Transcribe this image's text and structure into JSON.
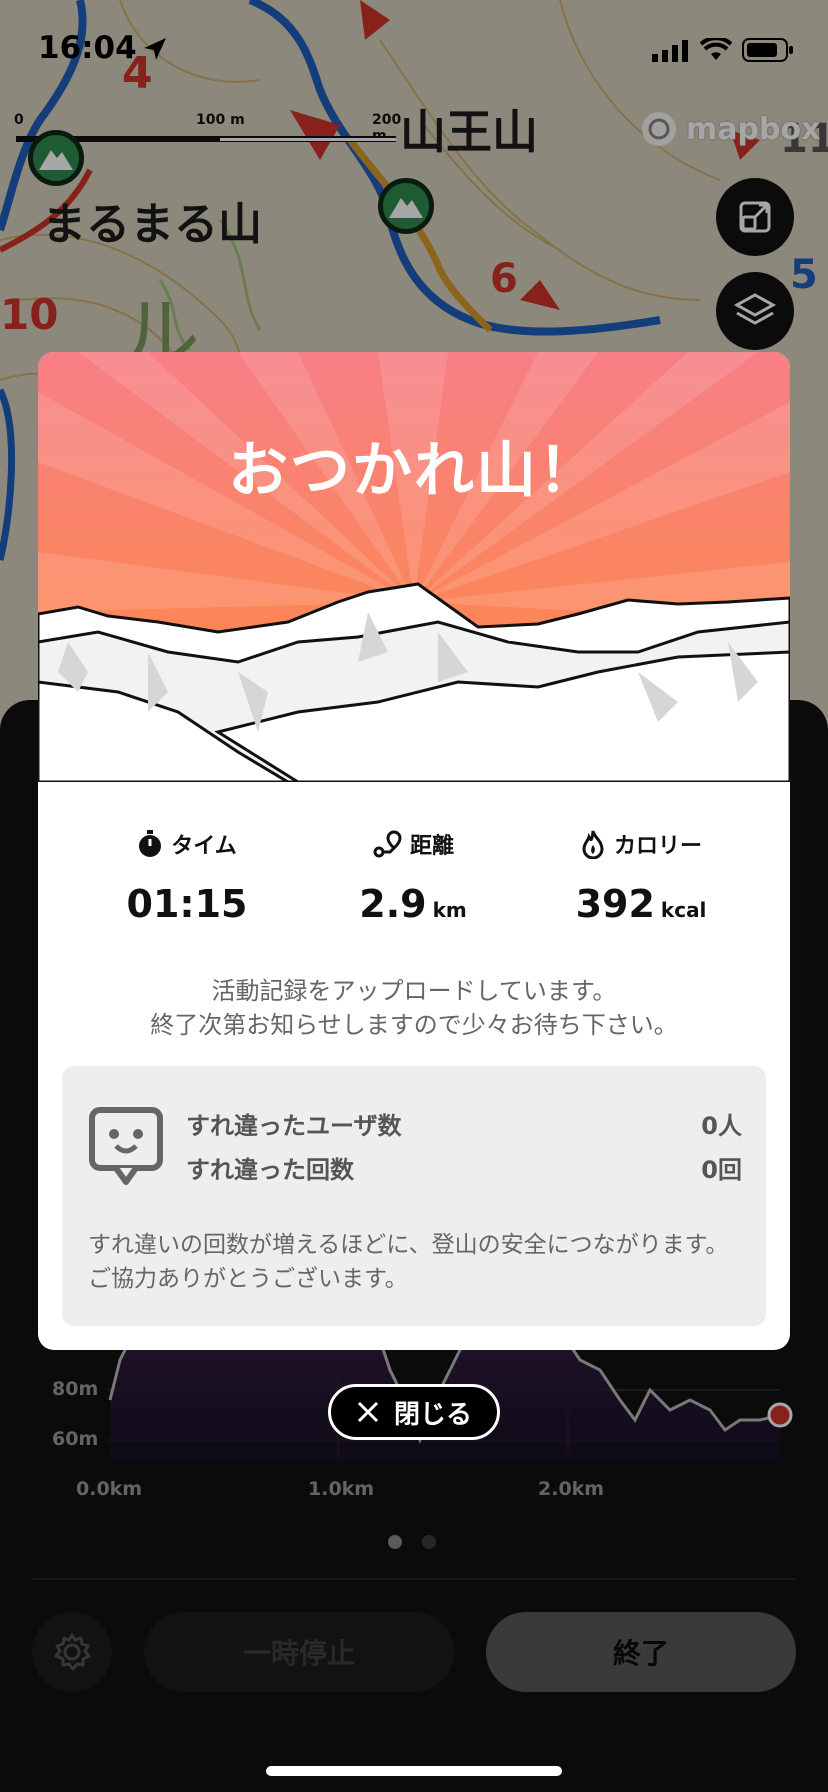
{
  "status_bar": {
    "time": "16:04"
  },
  "map": {
    "scale": {
      "zero": "0",
      "mid": "100 m",
      "max": "200 m"
    },
    "labels": {
      "peak1": "まるまる山",
      "peak2": "山王山",
      "n4": "4",
      "n6": "6",
      "n10": "10",
      "n11": "11",
      "n5": "5",
      "katakana": "ル"
    },
    "attribution": "mapbox"
  },
  "modal": {
    "title": "おつかれ山！",
    "stats": [
      {
        "label": "タイム",
        "value": "01:15",
        "unit": "",
        "icon": "stopwatch-icon"
      },
      {
        "label": "距離",
        "value": "2.9",
        "unit": "km",
        "icon": "route-pin-icon"
      },
      {
        "label": "カロリー",
        "value": "392",
        "unit": "kcal",
        "icon": "flame-icon"
      }
    ],
    "upload_message_line1": "活動記録をアップロードしています。",
    "upload_message_line2": "終了次第お知らせしますので少々お待ち下さい。",
    "passing": {
      "users_label": "すれ違ったユーザ数",
      "users_value": "0人",
      "count_label": "すれ違った回数",
      "count_value": "0回",
      "note": "すれ違いの回数が増えるほどに、登山の安全につながります。ご協力ありがとうございます。"
    }
  },
  "close_button": {
    "label": "閉じる"
  },
  "chart_data": {
    "type": "line",
    "x_ticks": [
      "0.0km",
      "1.0km",
      "2.0km"
    ],
    "y_ticks": [
      "80m",
      "60m"
    ]
  },
  "controls": {
    "pause_label": "一時停止",
    "end_label": "終了"
  },
  "colors": {
    "hero_top": "#f77f86",
    "hero_bottom": "#ff8a3d",
    "peak_green": "#2e8a4e"
  }
}
